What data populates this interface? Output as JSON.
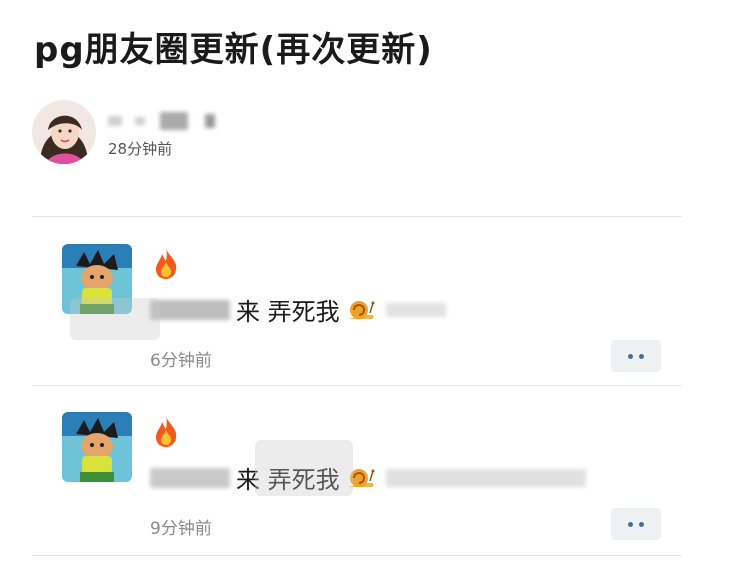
{
  "page": {
    "title": "pg朋友圈更新(再次更新)"
  },
  "post": {
    "author_time": "28分钟前"
  },
  "comments": [
    {
      "text": "来 弄死我",
      "time": "6分钟前"
    },
    {
      "text": "来 弄死我",
      "time": "9分钟前"
    }
  ],
  "icons": {
    "fire": "fire-emoji-icon",
    "snail": "snail-emoji-icon",
    "more": "more-dots-icon"
  },
  "colors": {
    "accent": "#4a6b91",
    "time_text": "#8a8a8a"
  }
}
